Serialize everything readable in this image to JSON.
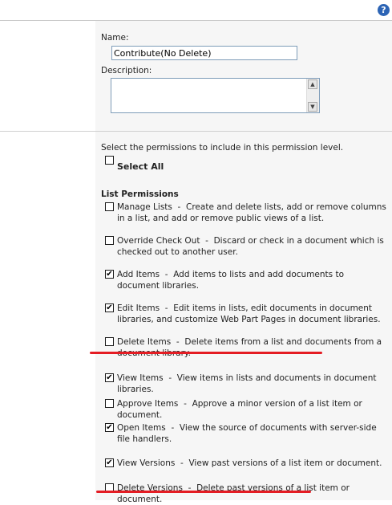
{
  "header": {
    "help_icon": "?"
  },
  "form": {
    "name_label": "Name:",
    "name_value": "Contribute(No Delete)",
    "description_label": "Description:",
    "select_instructions": "Select the permissions to include in this permission level.",
    "select_all_label": "Select All",
    "select_all_checked": false
  },
  "list_permissions": {
    "heading": "List Permissions",
    "items": [
      {
        "title": "Manage Lists",
        "description": "Create and delete lists, add or remove columns in a list, and add or remove public views of a list.",
        "checked": false
      },
      {
        "title": "Override Check Out",
        "description": "Discard or check in a document which is checked out to another user.",
        "checked": false
      },
      {
        "title": "Add Items",
        "description": "Add items to lists and add documents to document libraries.",
        "checked": true
      },
      {
        "title": "Edit Items",
        "description": "Edit items in lists, edit documents in document libraries, and customize Web Part Pages in document libraries.",
        "checked": true
      },
      {
        "title": "Delete Items",
        "description": "Delete items from a list and documents from a document library.",
        "checked": false
      },
      {
        "title": "View Items",
        "description": "View items in lists and documents in document libraries.",
        "checked": true
      },
      {
        "title": "Approve Items",
        "description": "Approve a minor version of a list item or document.",
        "checked": false
      },
      {
        "title": "Open Items",
        "description": "View the source of documents with server-side file handlers.",
        "checked": true
      },
      {
        "title": "View Versions",
        "description": "View past versions of a list item or document.",
        "checked": true
      },
      {
        "title": "Delete Versions",
        "description": "Delete past versions of a list item or document.",
        "checked": false
      }
    ]
  },
  "colors": {
    "accent_underline": "#e41c23",
    "help_icon": "#2c64b5"
  }
}
